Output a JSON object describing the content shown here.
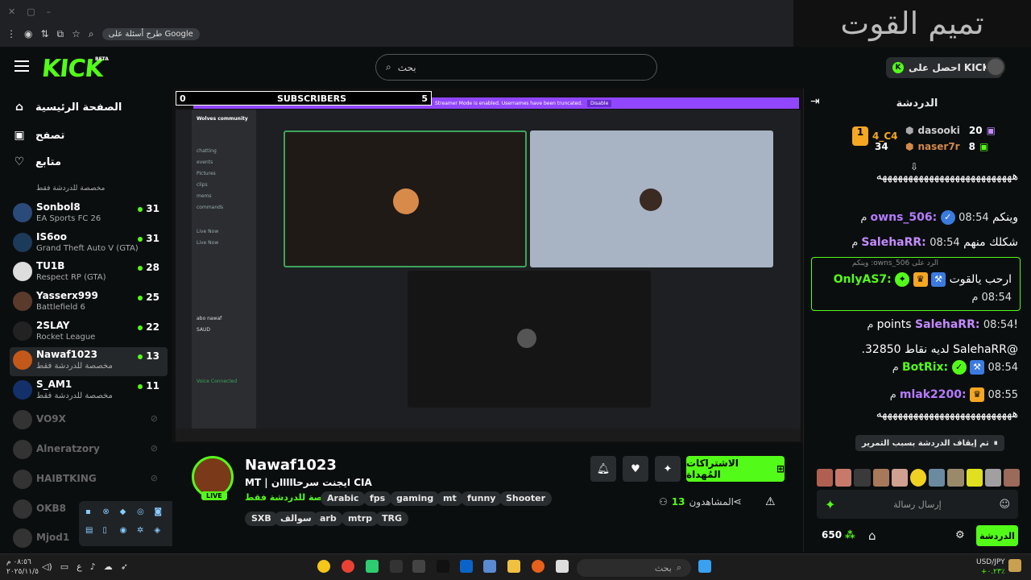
{
  "browser": {
    "google_chip": "طرح أسئلة على Google"
  },
  "overlay_title": "تميم القوت",
  "header": {
    "logo": "KICK",
    "beta": "BETA",
    "search_placeholder": "بحث",
    "get_kicks": "احصل على KICKs"
  },
  "nav": {
    "home": "الصفحة الرئيسية",
    "browse": "تصفح",
    "following": "متابع"
  },
  "sidebar_partial": "مخصصة للدردشة فقط",
  "channels": [
    {
      "name": "Sonbol8",
      "sub": "EA Sports FC 26",
      "viewers": "31",
      "online": true
    },
    {
      "name": "IS6oo",
      "sub": "Grand Theft Auto V (GTA)",
      "viewers": "31",
      "online": true
    },
    {
      "name": "TU1B",
      "sub": "Respect RP (GTA)",
      "viewers": "28",
      "online": true
    },
    {
      "name": "Yasserx999",
      "sub": "Battlefield 6",
      "viewers": "25",
      "online": true
    },
    {
      "name": "2SLAY",
      "sub": "Rocket League",
      "viewers": "22",
      "online": true
    },
    {
      "name": "Nawaf1023",
      "sub": "مخصصة للدردشة فقط",
      "viewers": "13",
      "online": true
    },
    {
      "name": "S_AM1",
      "sub": "مخصصة للدردشة فقط",
      "viewers": "11",
      "online": true
    },
    {
      "name": "VO9X",
      "online": false
    },
    {
      "name": "Alneratzory",
      "online": false
    },
    {
      "name": "HAIBTKING",
      "online": false
    },
    {
      "name": "OKB8",
      "online": false
    },
    {
      "name": "Mjod1",
      "online": false
    }
  ],
  "player": {
    "left_count": "0",
    "subscribers_label": "SUBSCRIBERS",
    "right_count": "5",
    "streamer_mode": "Streamer Mode is enabled. Usernames have been truncated.",
    "disable": "Disable",
    "discord_window": "Wolves community"
  },
  "discord": {
    "server": "Wolves community",
    "channels": [
      "chatting",
      "events",
      "Pictures",
      "clips",
      "mems",
      "commands",
      "Live Now",
      "Live Now",
      "abo nawaf",
      "SAUD",
      "Voice Connected"
    ]
  },
  "stream": {
    "channel": "Nawaf1023",
    "live": "LIVE",
    "title": "MT | ايجنت سرحااااان CIA",
    "category": "مخصصة للدردشة فقط",
    "tags_row1": [
      "Arabic",
      "fps",
      "gaming",
      "mt",
      "funny",
      "Shooter"
    ],
    "tags_row2": [
      "SXB",
      "سوالف",
      "arb",
      "mtrp",
      "TRG"
    ],
    "subscribe": "الاشتراكات المُهداة",
    "viewers_label": "المشاهدون",
    "viewers": "13"
  },
  "chat": {
    "title": "الدردشة",
    "leaderboard": [
      {
        "name": "4_C4",
        "rank": "1"
      },
      {
        "name": "dasooki",
        "count": "20"
      },
      {
        "name": "naser7r",
        "count": "8"
      },
      {
        "count": "34"
      }
    ],
    "messages": [
      {
        "text": "ههههههههههههههههههههههههههه"
      },
      {
        "time": "08:54 م",
        "user": "owns_506:",
        "text": "وينكم",
        "color": "#b57bff"
      },
      {
        "time": "08:54 م",
        "user": "SalehaRR:",
        "text": "شكلك منهم",
        "color": "#c48bff"
      },
      {
        "reply": "الرد على owns_506: وينكم",
        "time": "08:54 م",
        "user": "OnlyAS7:",
        "text": "ارحب يالقوت",
        "color": "#53fc18"
      },
      {
        "time": "08:54 م",
        "user": "SalehaRR:",
        "text": "!points",
        "color": "#c48bff"
      },
      {
        "time": "08:54 م",
        "user": "BotRix:",
        "text": "@SalehaRR لديه نقاط 32850.",
        "color": "#53fc18"
      },
      {
        "time": "08:55 م",
        "user": "mlak2200:",
        "text": "",
        "color": "#b57bff"
      },
      {
        "text": "ههههههههههههههههههههههههههه"
      }
    ],
    "paused": "تم إيقاف الدردشة بسبب التمرير",
    "input_placeholder": "إرسال رسالة",
    "points": "650",
    "send": "الدردشة"
  },
  "taskbar": {
    "search": "بحث",
    "time": "٠٨:٥٦ م",
    "date": "٢٠٢٥/١١/٥",
    "fx_pair": "USD/JPY",
    "fx_change": "+٠.٢٣٪"
  },
  "colors": {
    "kick_green": "#53fc18",
    "bg": "#0b0e0f",
    "streamer_bar": "#9146ff"
  }
}
